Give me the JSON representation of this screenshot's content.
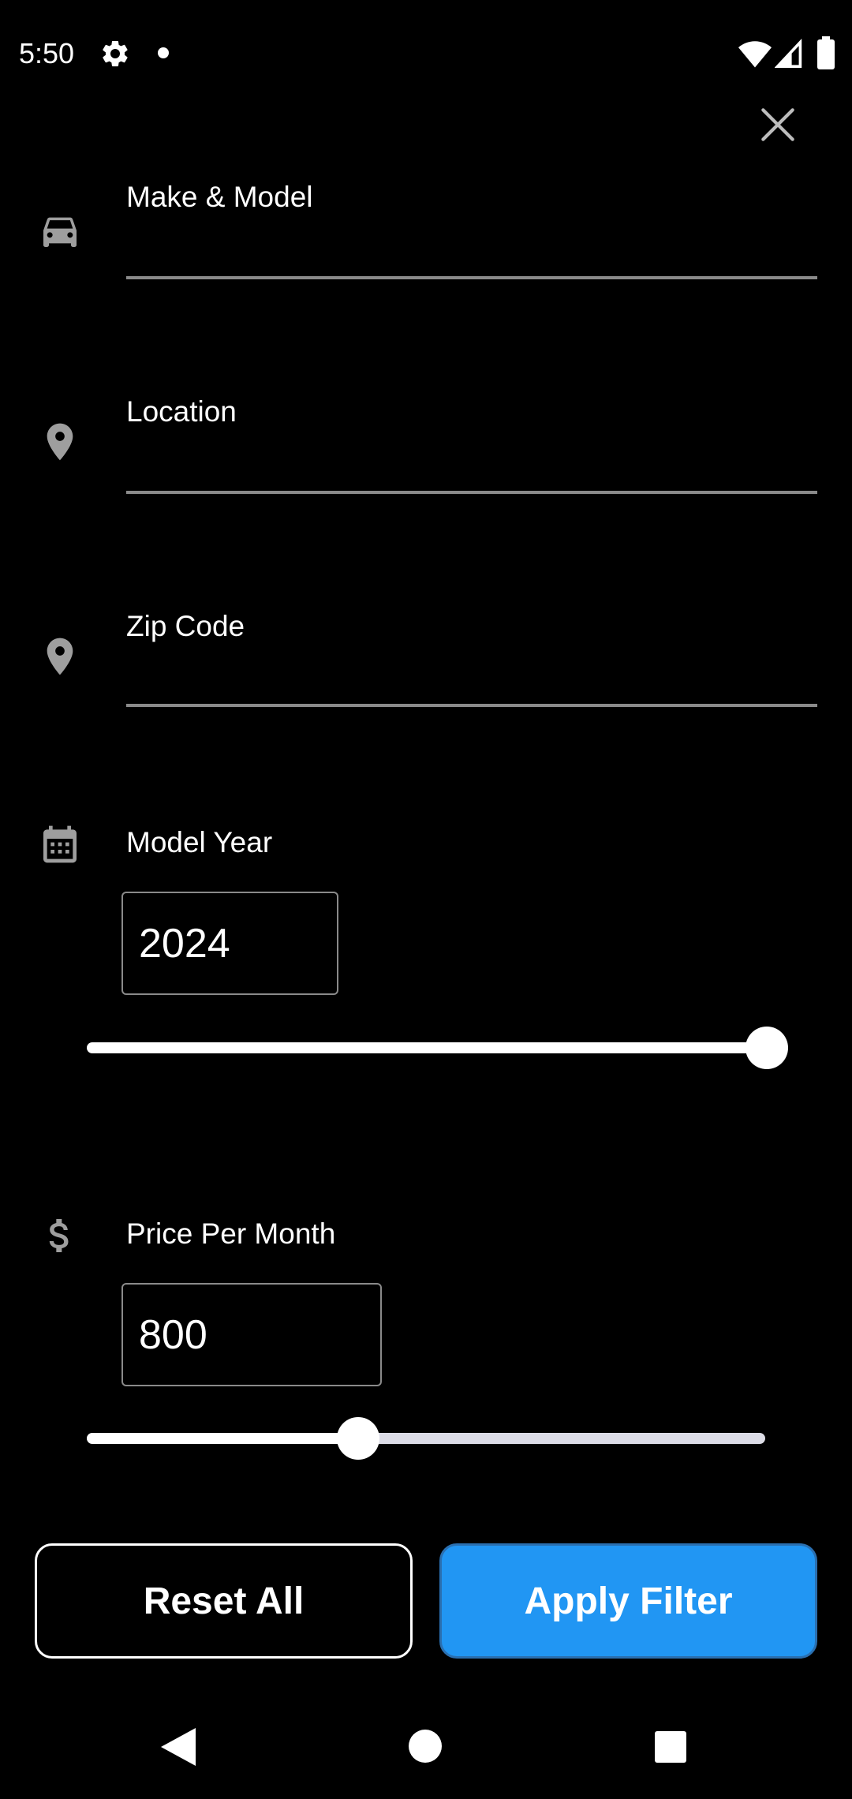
{
  "status_bar": {
    "time": "5:50",
    "icons": [
      "gear-icon",
      "notification-dot",
      "wifi-icon",
      "signal-icon",
      "battery-icon"
    ]
  },
  "close_icon": "close-icon",
  "fields": {
    "make_model": {
      "label": "Make & Model",
      "icon": "car-icon",
      "value": ""
    },
    "location": {
      "label": "Location",
      "icon": "location-pin-icon",
      "value": ""
    },
    "zip_code": {
      "label": "Zip Code",
      "icon": "location-pin-icon",
      "value": ""
    }
  },
  "model_year": {
    "label": "Model Year",
    "icon": "calendar-icon",
    "value": "2024",
    "slider_fraction": 1.0
  },
  "price": {
    "label": "Price Per Month",
    "icon": "dollar-icon",
    "value": "800",
    "slider_fraction": 0.4
  },
  "buttons": {
    "reset": "Reset All",
    "apply": "Apply Filter"
  },
  "nav": [
    "back-icon",
    "home-icon",
    "recents-icon"
  ],
  "colors": {
    "background": "#000000",
    "accent": "#2196f3",
    "divider": "#8a8a8a",
    "track_inactive": "#dcdce6"
  }
}
